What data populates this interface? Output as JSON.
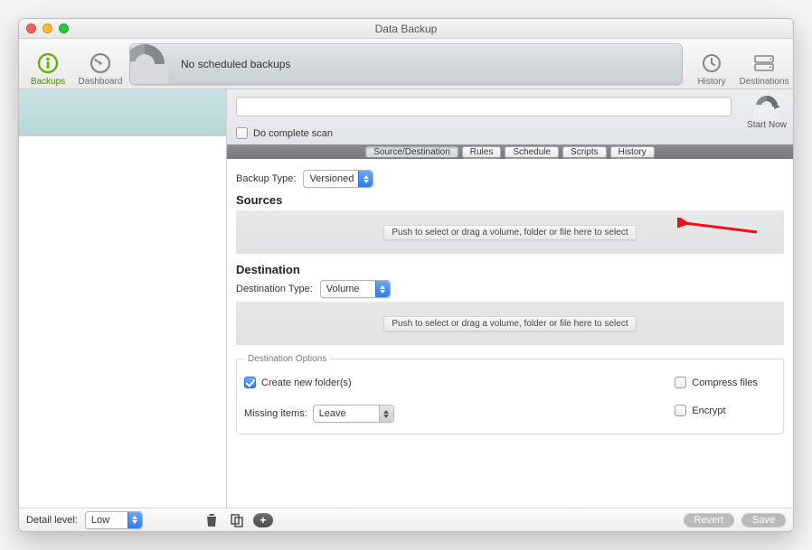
{
  "window": {
    "title": "Data Backup"
  },
  "toolbar": {
    "left": [
      {
        "name": "backups",
        "label": "Backups",
        "active": true
      },
      {
        "name": "dashboard",
        "label": "Dashboard",
        "active": false
      }
    ],
    "banner_text": "No scheduled backups",
    "right": [
      {
        "name": "history",
        "label": "History"
      },
      {
        "name": "destinations",
        "label": "Destinations"
      }
    ]
  },
  "main_header": {
    "name_value": "",
    "complete_scan_label": "Do complete scan",
    "complete_scan_checked": false,
    "start_now_label": "Start Now"
  },
  "tabs": {
    "items": [
      "Source/Destination",
      "Rules",
      "Schedule",
      "Scripts",
      "History"
    ],
    "active_index": 0
  },
  "content": {
    "backup_type_label": "Backup Type:",
    "backup_type_value": "Versioned",
    "sources_heading": "Sources",
    "sources_drop_hint": "Push to select or drag a volume, folder or file here to select",
    "destination_heading": "Destination",
    "destination_type_label": "Destination Type:",
    "destination_type_value": "Volume",
    "destination_drop_hint": "Push to select or drag a volume, folder or file here to select",
    "dest_options_legend": "Destination Options",
    "create_new_folders_label": "Create new folder(s)",
    "create_new_folders_checked": true,
    "missing_items_label": "Missing items:",
    "missing_items_value": "Leave",
    "compress_files_label": "Compress files",
    "compress_files_checked": false,
    "encrypt_label": "Encrypt",
    "encrypt_checked": false
  },
  "footer": {
    "detail_level_label": "Detail level:",
    "detail_level_value": "Low",
    "revert_label": "Revert",
    "save_label": "Save"
  }
}
